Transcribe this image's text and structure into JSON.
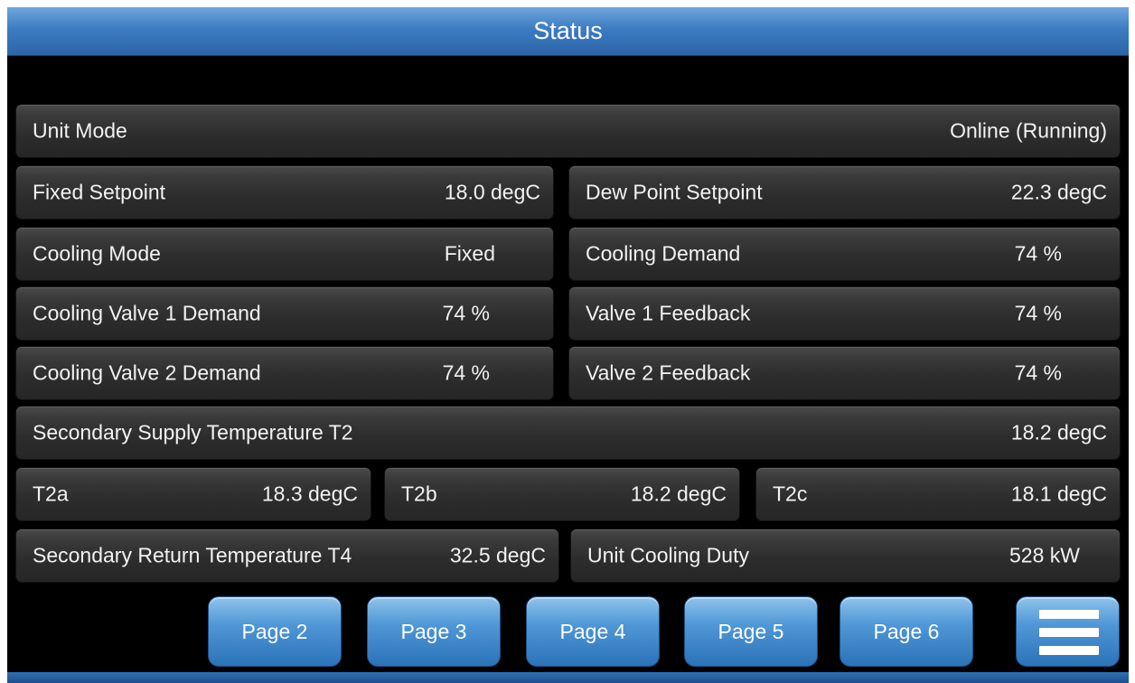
{
  "header": {
    "title": "Status"
  },
  "rows": {
    "unit_mode": {
      "label": "Unit Mode",
      "value": "Online (Running)"
    },
    "fixed_setpoint": {
      "label": "Fixed Setpoint",
      "value": "18.0 degC"
    },
    "dew_point_setpoint": {
      "label": "Dew Point Setpoint",
      "value": "22.3 degC"
    },
    "cooling_mode": {
      "label": "Cooling Mode",
      "value": "Fixed"
    },
    "cooling_demand": {
      "label": "Cooling Demand",
      "value": "74 %"
    },
    "cooling_valve_1_demand": {
      "label": "Cooling Valve 1 Demand",
      "value": "74 %"
    },
    "valve_1_feedback": {
      "label": "Valve 1 Feedback",
      "value": "74 %"
    },
    "cooling_valve_2_demand": {
      "label": "Cooling Valve 2 Demand",
      "value": "74 %"
    },
    "valve_2_feedback": {
      "label": "Valve 2 Feedback",
      "value": "74 %"
    },
    "secondary_supply_temp": {
      "label": "Secondary Supply Temperature T2",
      "value": "18.2 degC"
    },
    "t2a": {
      "label": "T2a",
      "value": "18.3 degC"
    },
    "t2b": {
      "label": "T2b",
      "value": "18.2 degC"
    },
    "t2c": {
      "label": "T2c",
      "value": "18.1 degC"
    },
    "secondary_return_temp": {
      "label": "Secondary Return Temperature T4",
      "value": "32.5 degC"
    },
    "unit_cooling_duty": {
      "label": "Unit Cooling Duty",
      "value": "528 kW"
    }
  },
  "nav": {
    "buttons": [
      "Page 2",
      "Page 3",
      "Page 4",
      "Page 5",
      "Page 6"
    ],
    "menu_icon": "hamburger-menu-icon"
  }
}
